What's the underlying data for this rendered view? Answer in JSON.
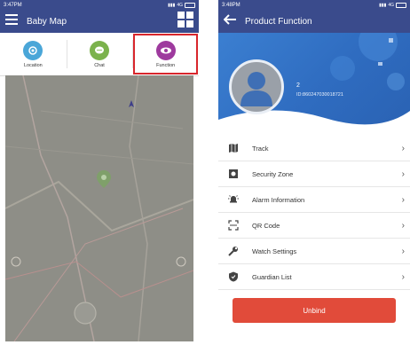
{
  "left": {
    "status_time": "3:47PM",
    "status_network": "4G",
    "title": "Baby Map",
    "tabs": [
      {
        "label": "Location",
        "color": "#4aa6d8",
        "icon": "location-icon"
      },
      {
        "label": "Chat",
        "color": "#7bb24c",
        "icon": "chat-icon"
      },
      {
        "label": "Function",
        "color": "#9e3a9e",
        "icon": "function-icon"
      }
    ],
    "selected_tab": "Function"
  },
  "right": {
    "status_time": "3:48PM",
    "status_network": "4G",
    "title": "Product Function",
    "device_name": "2",
    "device_id": "ID:860247030018721",
    "menu": [
      {
        "label": "Track",
        "icon": "map-icon"
      },
      {
        "label": "Security Zone",
        "icon": "security-zone-icon"
      },
      {
        "label": "Alarm Information",
        "icon": "alarm-icon"
      },
      {
        "label": "QR Code",
        "icon": "qr-code-icon"
      },
      {
        "label": "Watch Settings",
        "icon": "wrench-icon"
      },
      {
        "label": "Guardian List",
        "icon": "shield-icon"
      }
    ],
    "unbind_label": "Unbind",
    "accent": "#3a4b8c",
    "unbind_color": "#e14b3a"
  }
}
